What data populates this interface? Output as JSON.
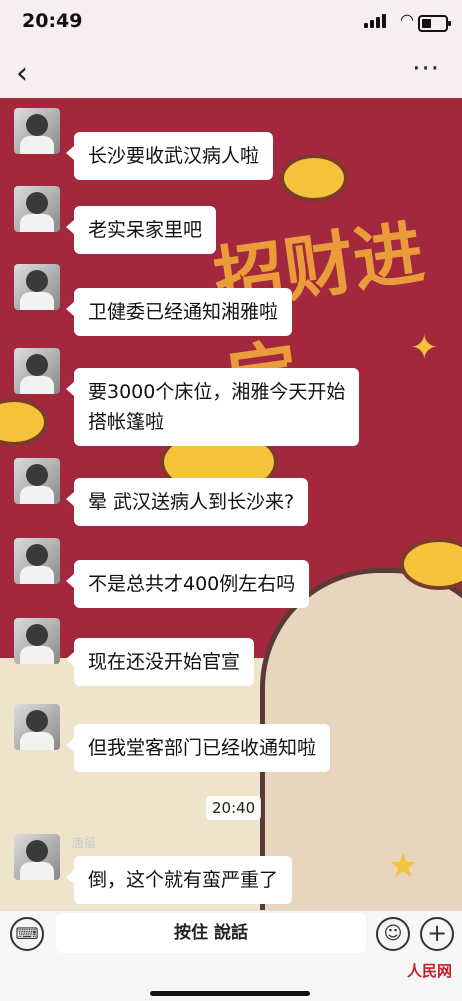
{
  "status_bar": {
    "time": "20:49"
  },
  "nav": {
    "back_icon": "chevron-left-icon",
    "more_icon": "more-dots-icon",
    "more_label": "···"
  },
  "background_art": {
    "banner_text": "招财进宝"
  },
  "messages": [
    {
      "nickname": "",
      "text": "长沙要收武汉病人啦"
    },
    {
      "nickname": "",
      "text": "老实呆家里吧"
    },
    {
      "nickname": "",
      "text": "卫健委已经通知湘雅啦"
    },
    {
      "nickname": "",
      "text": "要3000个床位，湘雅今天开始\n搭帐篷啦"
    },
    {
      "nickname": "",
      "text": "晕 武汉送病人到长沙来?"
    },
    {
      "nickname": "",
      "text": "不是总共才400例左右吗"
    },
    {
      "nickname": "",
      "text": "现在还没开始官宣"
    },
    {
      "nickname": "",
      "text": "但我堂客部门已经收通知啦"
    },
    {
      "nickname": "唐挺",
      "text": "倒，这个就有蛮严重了"
    }
  ],
  "timestamp": "20:40",
  "input_bar": {
    "keyboard_icon": "keyboard-icon",
    "hold_to_talk_label": "按住 說話",
    "emoji_icon": "emoji-icon",
    "plus_icon": "plus-icon",
    "plus_label": "+"
  },
  "watermark": {
    "text": "人民网"
  },
  "colors": {
    "chat_bg": "#a3283d",
    "bubble": "#ffffff",
    "banner_gold": "#f2a93b"
  }
}
